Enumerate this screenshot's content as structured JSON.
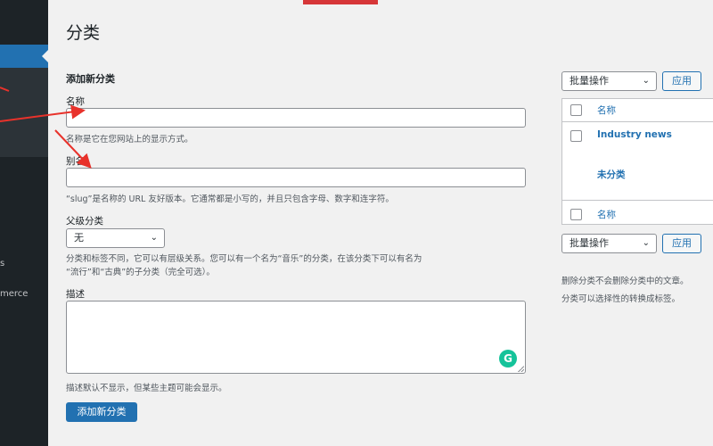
{
  "header": {
    "title": "分类"
  },
  "sidebar": {
    "items": [
      "s",
      "merce"
    ]
  },
  "form": {
    "section_title": "添加新分类",
    "name_label": "名称",
    "name_value": "",
    "name_help": "名称是它在您网站上的显示方式。",
    "slug_label": "别名",
    "slug_value": "",
    "slug_help": "“slug”是名称的 URL 友好版本。它通常都是小写的，并且只包含字母、数字和连字符。",
    "parent_label": "父级分类",
    "parent_selected": "无",
    "parent_help_line1": "分类和标签不同，它可以有层级关系。您可以有一个名为“音乐”的分类，在该分类下可以有名为",
    "parent_help_line2": "“流行”和“古典”的子分类（完全可选）。",
    "description_label": "描述",
    "description_value": "",
    "description_help": "描述默认不显示，但某些主题可能会显示。",
    "submit_label": "添加新分类"
  },
  "table": {
    "bulk_actions_label": "批量操作",
    "apply_label": "应用",
    "column_name": "名称",
    "rows": [
      {
        "name": "Industry news"
      },
      {
        "name": "未分类"
      }
    ],
    "footer_column_name": "名称",
    "bulk_actions_bottom_label": "批量操作",
    "apply_bottom_label": "应用",
    "note_line1": "删除分类不会删除分类中的文章。",
    "note_line2": "分类可以选择性的转换成标签。"
  },
  "colors": {
    "accent": "#2271b1",
    "annotation": "#e8322b",
    "sidebar": "#1d2327"
  },
  "icons": {
    "grammarly": "G",
    "chevron": "⌄"
  }
}
